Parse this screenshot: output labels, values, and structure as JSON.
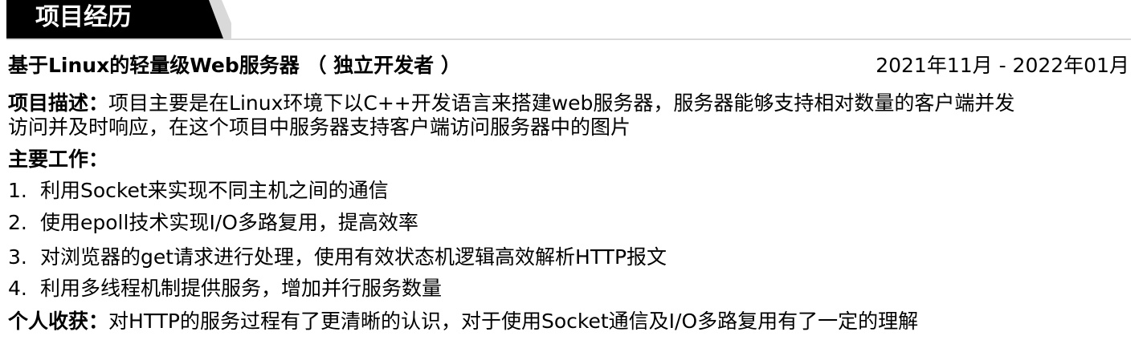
{
  "section": {
    "title": "项目经历"
  },
  "project": {
    "name": "基于Linux的轻量级Web服务器 （ 独立开发者 ）",
    "date": "2021年11月  - 2022年01月",
    "description_label": "项目描述：",
    "description_line1": "项目主要是在Linux环境下以C++开发语言来搭建web服务器，服务器能够支持相对数量的客户端并发",
    "description_line2": "访问并及时响应，在这个项目中服务器支持客户端访问服务器中的图片",
    "work_label": "主要工作：",
    "work_items": [
      {
        "num": "1.",
        "text": "利用Socket来实现不同主机之间的通信"
      },
      {
        "num": "2.",
        "text": "使用epoll技术实现I/O多路复用，提高效率"
      },
      {
        "num": "3.",
        "text": "对浏览器的get请求进行处理，使用有效状态机逻辑高效解析HTTP报文"
      },
      {
        "num": "4.",
        "text": "利用多线程机制提供服务，增加并行服务数量"
      }
    ],
    "gain_label": "个人收获：",
    "gain_text": "对HTTP的服务过程有了更清晰的认识，对于使用Socket通信及I/O多路复用有了一定的理解"
  },
  "colors": {
    "tab": "#000000",
    "tab_accent": "#d9d9d9",
    "rule": "#d9d9d9",
    "text": "#000000"
  }
}
